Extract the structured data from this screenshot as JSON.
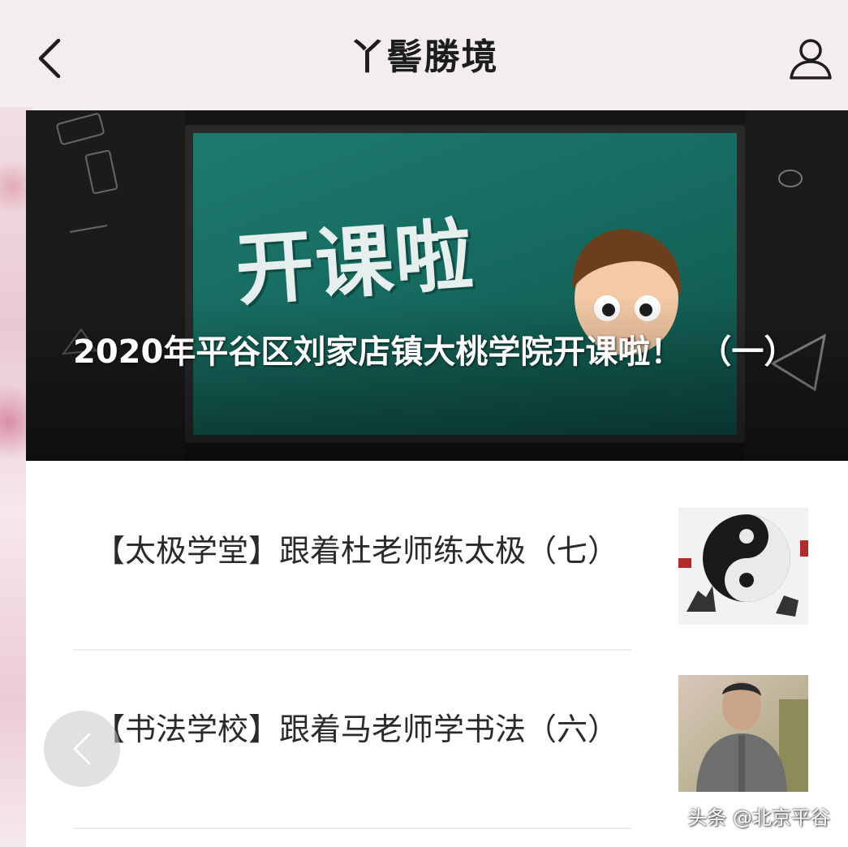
{
  "header": {
    "title": "丫髻勝境",
    "back_icon": "chevron-left-icon",
    "profile_icon": "user-icon"
  },
  "banner": {
    "poster_text": "开课啦",
    "title": "2020年平谷区刘家店镇大桃学院开课啦！　（一）"
  },
  "articles": [
    {
      "title": "【太极学堂】跟着杜老师练太极（七）",
      "thumbnail": "taiji-thumbnail"
    },
    {
      "title": "【书法学校】跟着马老师学书法（六）",
      "thumbnail": "teacher-portrait-thumbnail"
    }
  ],
  "watermark": "头条 @北京平谷",
  "colors": {
    "header_bg": "#f4eded",
    "board_green": "#1f7a6e",
    "text_primary": "#2a2a2a"
  }
}
